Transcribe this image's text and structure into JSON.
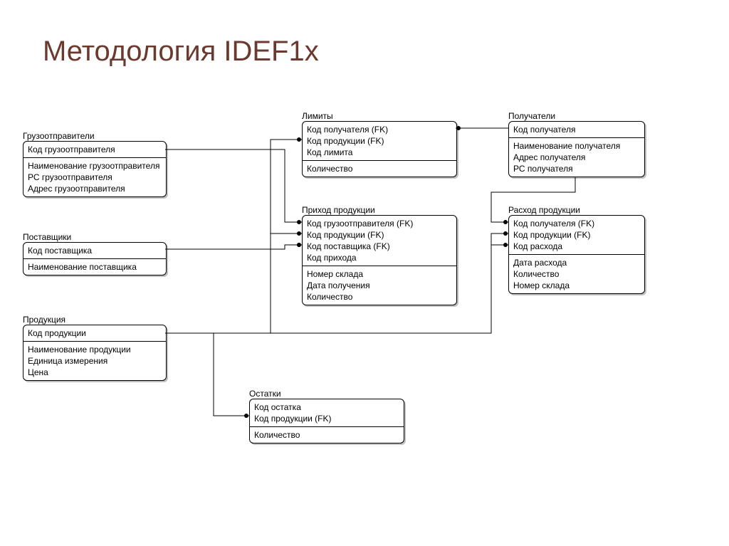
{
  "title": "Методология IDEF1x",
  "entities": {
    "shippers": {
      "label": "Грузоотправители",
      "pk": [
        "Код грузоотправителя"
      ],
      "attrs": [
        "Наименование грузоотправителя",
        "РС грузоотправителя",
        "Адрес грузоотправителя"
      ]
    },
    "suppliers": {
      "label": "Поставщики",
      "pk": [
        "Код поставщика"
      ],
      "attrs": [
        "Наименование поставщика"
      ]
    },
    "products": {
      "label": "Продукция",
      "pk": [
        "Код продукции"
      ],
      "attrs": [
        "Наименование продукции",
        "Единица измерения",
        "Цена"
      ]
    },
    "limits": {
      "label": "Лимиты",
      "pk": [
        "Код получателя (FK)",
        "Код продукции (FK)",
        "Код лимита"
      ],
      "attrs": [
        "Количество"
      ]
    },
    "incoming": {
      "label": "Приход продукции",
      "pk": [
        "Код грузоотправителя (FK)",
        "Код продукции (FK)",
        "Код поставщика (FK)",
        "Код прихода"
      ],
      "attrs": [
        "Номер склада",
        "Дата получения",
        "Количество"
      ]
    },
    "remains": {
      "label": "Остатки",
      "pk": [
        "Код остатка",
        "Код продукции (FK)"
      ],
      "attrs": [
        "Количество"
      ]
    },
    "recipients": {
      "label": "Получатели",
      "pk": [
        "Код получателя"
      ],
      "attrs": [
        "Наименование получателя",
        "Адрес получателя",
        "РС получателя"
      ]
    },
    "outgoing": {
      "label": "Расход продукции",
      "pk": [
        "Код получателя (FK)",
        "Код продукции (FK)",
        "Код расхода"
      ],
      "attrs": [
        "Дата расхода",
        "Количество",
        "Номер склада"
      ]
    }
  }
}
